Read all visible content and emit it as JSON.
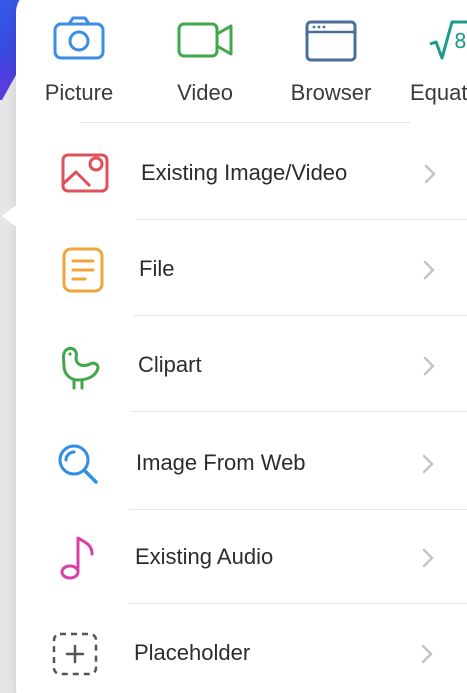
{
  "top_items": [
    {
      "label": "Picture",
      "icon": "camera-icon",
      "color": "#3b8ee6"
    },
    {
      "label": "Video",
      "icon": "video-camera-icon",
      "color": "#3fa84a"
    },
    {
      "label": "Browser",
      "icon": "browser-window-icon",
      "color": "#4a6e98"
    },
    {
      "label": "Equat",
      "icon": "square-root-icon",
      "color": "#1a9c8c"
    }
  ],
  "list_items": [
    {
      "label": "Existing Image/Video",
      "icon": "image-icon",
      "color": "#e0505a"
    },
    {
      "label": "File",
      "icon": "document-icon",
      "color": "#f0a43a"
    },
    {
      "label": "Clipart",
      "icon": "bird-icon",
      "color": "#3fa84a"
    },
    {
      "label": "Image From Web",
      "icon": "magnifier-icon",
      "color": "#2f8ee6"
    },
    {
      "label": "Existing Audio",
      "icon": "music-note-icon",
      "color": "#d640a8"
    },
    {
      "label": "Placeholder",
      "icon": "placeholder-plus-icon",
      "color": "#555558"
    }
  ]
}
